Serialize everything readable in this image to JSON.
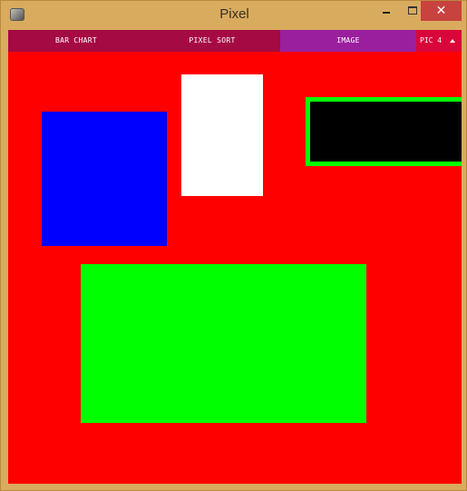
{
  "window": {
    "title": "Pixel",
    "close_glyph": "✕"
  },
  "menu": {
    "tabs": [
      {
        "label": "BAR CHART",
        "color": "#a60a43"
      },
      {
        "label": "PIXEL SORT",
        "color": "#a60a43"
      },
      {
        "label": "IMAGE",
        "color": "#9a1f9e",
        "selected": true
      }
    ],
    "picture_select": {
      "value": "PIC 4",
      "color": "#d8063a",
      "icon": "caret-up-icon"
    }
  },
  "canvas": {
    "background": "#ff0000",
    "shapes": [
      {
        "name": "white-rectangle",
        "color": "#ffffff"
      },
      {
        "name": "blue-rectangle",
        "color": "#0000ff"
      },
      {
        "name": "black-rectangle",
        "color": "#000000",
        "outline": "#00ff00"
      },
      {
        "name": "green-rectangle",
        "color": "#00ff00"
      }
    ]
  }
}
